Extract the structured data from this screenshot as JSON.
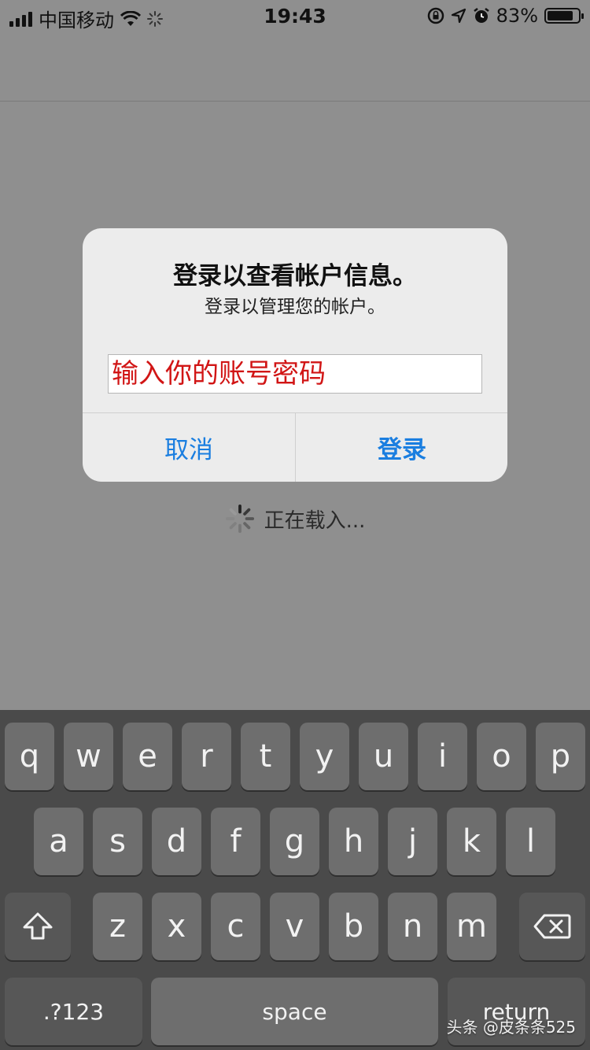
{
  "status_bar": {
    "carrier": "中国移动",
    "time": "19:43",
    "battery_percent": "83%",
    "battery_level": 0.83,
    "icons": [
      "signal-icon",
      "wifi-icon",
      "activity-spinner-icon",
      "rotation-lock-icon",
      "location-arrow-icon",
      "alarm-icon",
      "battery-icon"
    ]
  },
  "alert": {
    "title": "登录以查看帐户信息。",
    "message": "登录以管理您的帐户。",
    "input_value": "输入你的账号密码",
    "cancel_label": "取消",
    "login_label": "登录"
  },
  "loading": {
    "text": "正在载入..."
  },
  "keyboard": {
    "row1": [
      "q",
      "w",
      "e",
      "r",
      "t",
      "y",
      "u",
      "i",
      "o",
      "p"
    ],
    "row2": [
      "a",
      "s",
      "d",
      "f",
      "g",
      "h",
      "j",
      "k",
      "l"
    ],
    "row3": [
      "z",
      "x",
      "c",
      "v",
      "b",
      "n",
      "m"
    ],
    "numbers_label": ".?123",
    "space_label": "space",
    "return_label": "return"
  },
  "watermark": "头条 @皮条条525",
  "colors": {
    "accent": "#1a7ee0",
    "annotation_red": "#d11515",
    "overlay": "#8f8f8f",
    "keyboard_bg": "#4a4a4a"
  }
}
